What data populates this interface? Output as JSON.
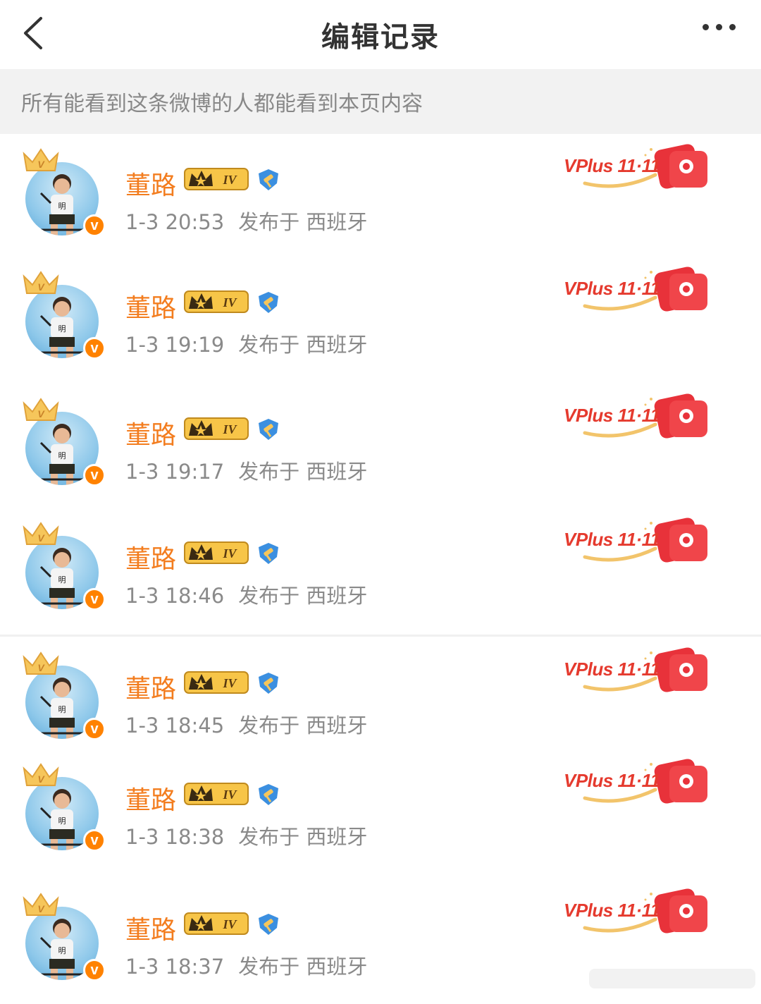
{
  "header": {
    "title": "编辑记录"
  },
  "notice": {
    "text": "所有能看到这条微博的人都能看到本页内容"
  },
  "records": [
    {
      "name": "董路",
      "time": "1-3 20:53",
      "location": "发布于 西班牙",
      "level": "IV",
      "promo": "VPlus 11·11"
    },
    {
      "name": "董路",
      "time": "1-3 19:19",
      "location": "发布于 西班牙",
      "level": "IV",
      "promo": "VPlus 11·11"
    },
    {
      "name": "董路",
      "time": "1-3 19:17",
      "location": "发布于 西班牙",
      "level": "IV",
      "promo": "VPlus 11·11"
    },
    {
      "name": "董路",
      "time": "1-3 18:46",
      "location": "发布于 西班牙",
      "level": "IV",
      "promo": "VPlus 11·11"
    },
    {
      "name": "董路",
      "time": "1-3 18:45",
      "location": "发布于 西班牙",
      "level": "IV",
      "promo": "VPlus 11·11"
    },
    {
      "name": "董路",
      "time": "1-3 18:38",
      "location": "发布于 西班牙",
      "level": "IV",
      "promo": "VPlus 11·11"
    },
    {
      "name": "董路",
      "time": "1-3 18:37",
      "location": "发布于 西班牙",
      "level": "IV",
      "promo": "VPlus 11·11"
    }
  ],
  "colors": {
    "name": "#f37d1f",
    "verified": "#ff8200",
    "promo": "#e53a2e"
  }
}
